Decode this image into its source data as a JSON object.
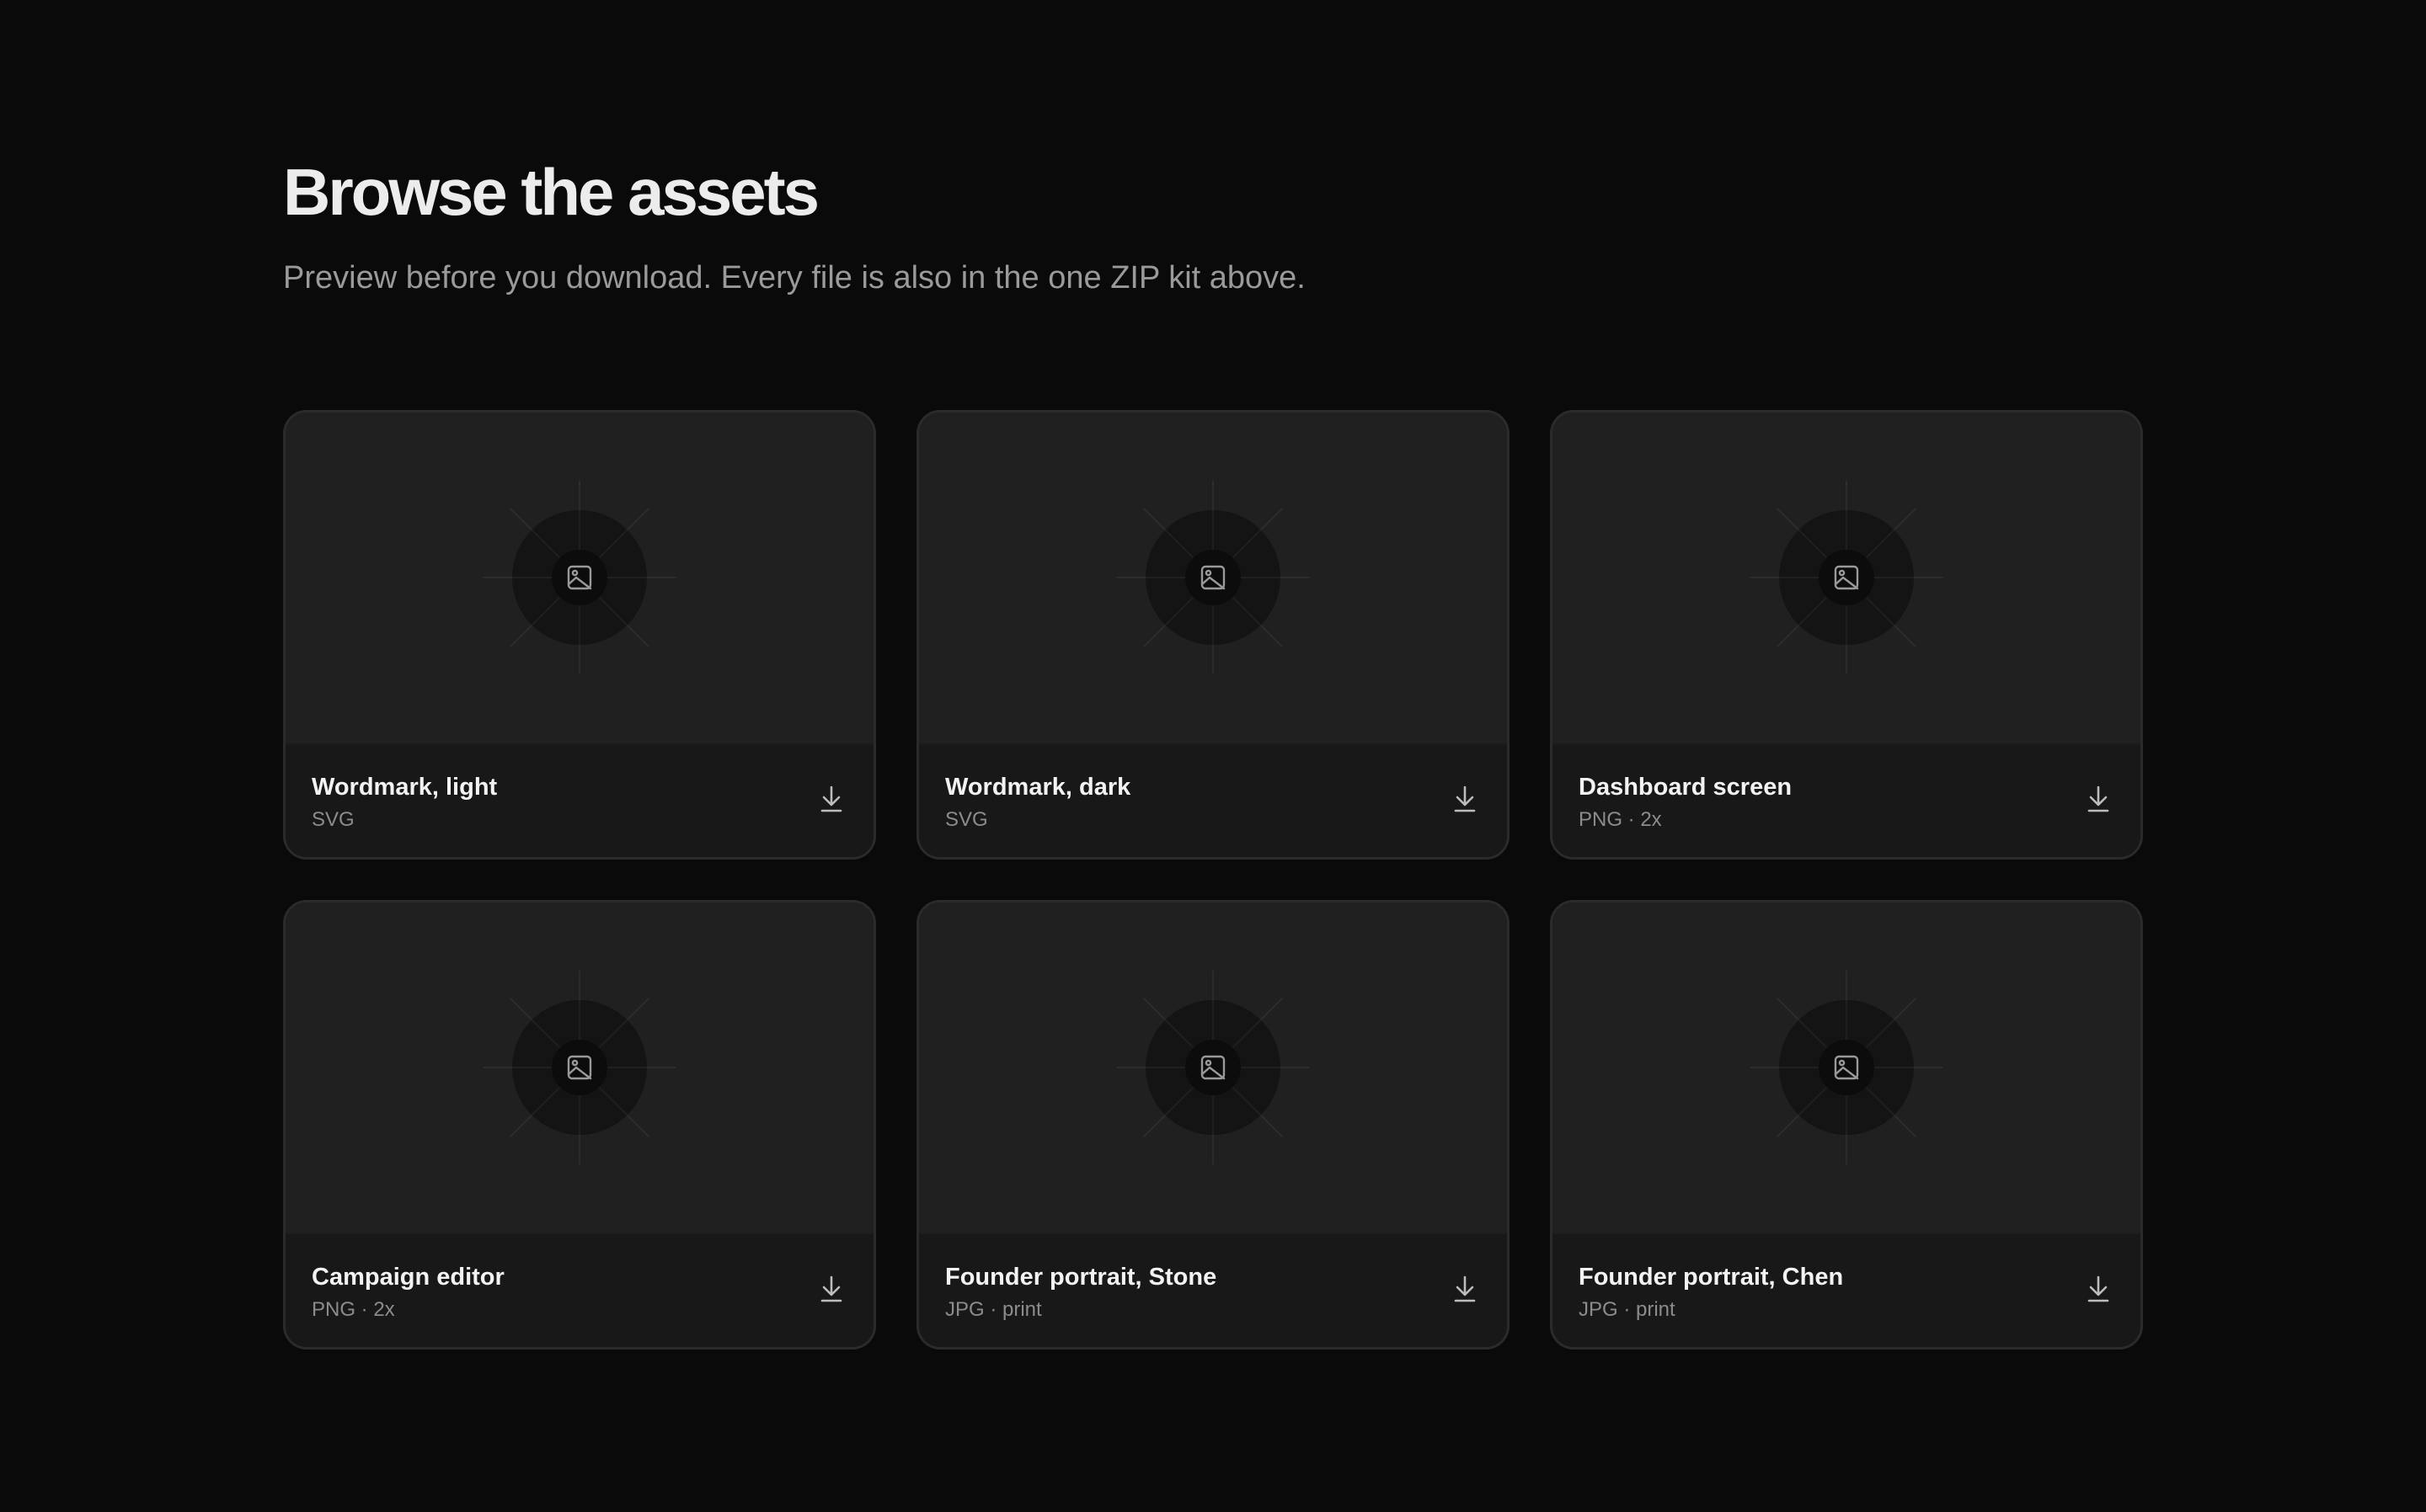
{
  "section": {
    "title": "Browse the assets",
    "subtitle": "Preview before you download. Every file is also in the one ZIP kit above."
  },
  "icons": {
    "preview": "image-icon",
    "download": "download-icon"
  },
  "colors": {
    "background": "#0a0a0a",
    "card": "#181818",
    "preview": "#202020",
    "text": "#f3f3f3",
    "muted": "#8c8c8c"
  },
  "assets": [
    {
      "name": "Wordmark, light",
      "meta": "SVG"
    },
    {
      "name": "Wordmark, dark",
      "meta": "SVG"
    },
    {
      "name": "Dashboard screen",
      "meta": "PNG · 2x"
    },
    {
      "name": "Campaign editor",
      "meta": "PNG · 2x"
    },
    {
      "name": "Founder portrait, Stone",
      "meta": "JPG · print"
    },
    {
      "name": "Founder portrait, Chen",
      "meta": "JPG · print"
    }
  ]
}
